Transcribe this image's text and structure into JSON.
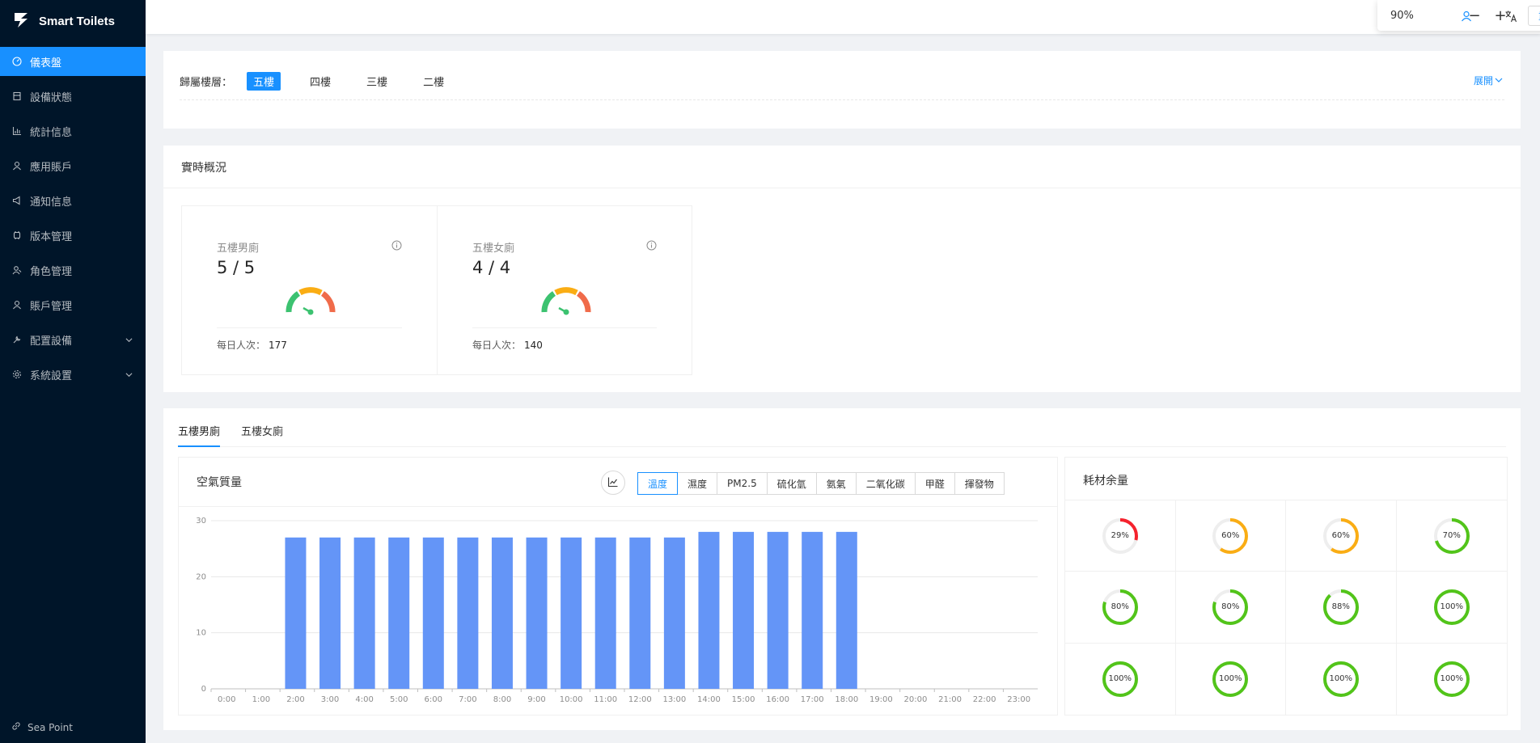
{
  "app": {
    "name": "Smart Toilets",
    "footer": "Sea Point"
  },
  "sidebar": {
    "items": [
      {
        "label": "儀表盤",
        "icon": "dashboard-icon",
        "active": true
      },
      {
        "label": "設備狀態",
        "icon": "device-icon"
      },
      {
        "label": "統計信息",
        "icon": "chart-icon"
      },
      {
        "label": "應用賬戶",
        "icon": "user-icon"
      },
      {
        "label": "通知信息",
        "icon": "notification-icon"
      },
      {
        "label": "版本管理",
        "icon": "version-icon"
      },
      {
        "label": "角色管理",
        "icon": "role-icon"
      },
      {
        "label": "賬戶管理",
        "icon": "account-icon"
      },
      {
        "label": "配置設備",
        "icon": "config-icon",
        "expandable": true
      },
      {
        "label": "系統設置",
        "icon": "settings-icon",
        "expandable": true
      }
    ]
  },
  "header": {
    "zoom": "90%",
    "zoom_out": "−",
    "zoom_in": "+",
    "reset": "重設"
  },
  "floor": {
    "label": "歸屬樓層：",
    "options": [
      "五樓",
      "四樓",
      "三樓",
      "二樓"
    ],
    "selected": "五樓",
    "expand": "展開"
  },
  "overview": {
    "title": "實時概況",
    "stats": [
      {
        "name": "五樓男廁",
        "value": "5 / 5",
        "daily_label": "每日人次：",
        "daily": "177"
      },
      {
        "name": "五樓女廁",
        "value": "4 / 4",
        "daily_label": "每日人次：",
        "daily": "140"
      }
    ]
  },
  "detail": {
    "tabs": [
      "五樓男廁",
      "五樓女廁"
    ],
    "active_tab": "五樓男廁",
    "air_title": "空氣質量",
    "metrics": [
      "溫度",
      "濕度",
      "PM2.5",
      "硫化氫",
      "氨氣",
      "二氧化碳",
      "甲醛",
      "揮發物"
    ],
    "active_metric": "溫度",
    "consumables_title": "耗材余量",
    "consumables": [
      29,
      60,
      60,
      70,
      80,
      80,
      88,
      100,
      100,
      100,
      100,
      100
    ]
  },
  "colors": {
    "accent": "#1890ff",
    "bar": "#6495f7",
    "red": "#f5222d",
    "orange": "#faad14",
    "green": "#52c41a"
  },
  "chart_data": {
    "type": "bar",
    "categories": [
      "0:00",
      "1:00",
      "2:00",
      "3:00",
      "4:00",
      "5:00",
      "6:00",
      "7:00",
      "8:00",
      "9:00",
      "10:00",
      "11:00",
      "12:00",
      "13:00",
      "14:00",
      "15:00",
      "16:00",
      "17:00",
      "18:00",
      "19:00",
      "20:00",
      "21:00",
      "22:00",
      "23:00"
    ],
    "values": [
      0,
      0,
      27,
      27,
      27,
      27,
      27,
      27,
      27,
      27,
      27,
      27,
      27,
      27,
      28,
      28,
      28,
      28,
      28,
      0,
      0,
      0,
      0,
      0
    ],
    "yticks": [
      0,
      10,
      20,
      30
    ],
    "ylim": [
      0,
      30
    ]
  }
}
